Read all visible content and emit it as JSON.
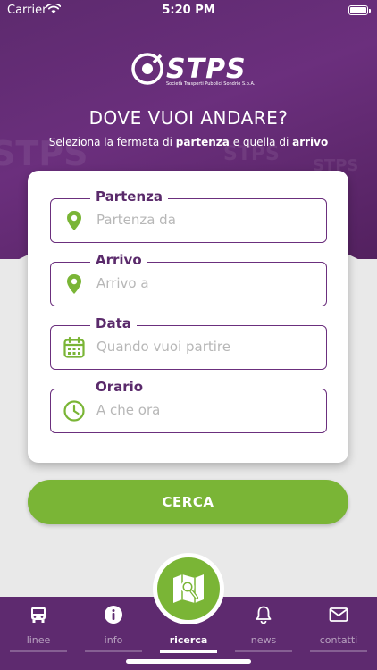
{
  "status_bar": {
    "carrier": "Carrier",
    "time": "5:20 PM"
  },
  "brand": {
    "name": "STPS",
    "tagline": "Società Trasporti Pubblici Sondrio S.p.A."
  },
  "header": {
    "title": "DOVE VUOI ANDARE?",
    "subtitle_prefix": "Seleziona la fermata di ",
    "subtitle_bold_1": "partenza",
    "subtitle_mid": " e quella di ",
    "subtitle_bold_2": "arrivo"
  },
  "form": {
    "fields": [
      {
        "label": "Partenza",
        "placeholder": "Partenza da",
        "icon": "location-pin-icon"
      },
      {
        "label": "Arrivo",
        "placeholder": "Arrivo a",
        "icon": "location-pin-icon"
      },
      {
        "label": "Data",
        "placeholder": "Quando vuoi partire",
        "icon": "calendar-icon"
      },
      {
        "label": "Orario",
        "placeholder": "A che ora",
        "icon": "clock-icon"
      }
    ],
    "submit_label": "CERCA"
  },
  "tabs": [
    {
      "label": "linee",
      "icon": "bus-icon",
      "active": false
    },
    {
      "label": "info",
      "icon": "info-icon",
      "active": false
    },
    {
      "label": "ricerca",
      "icon": "map-search-icon",
      "active": true
    },
    {
      "label": "news",
      "icon": "bell-icon",
      "active": false
    },
    {
      "label": "contatti",
      "icon": "mail-icon",
      "active": false
    }
  ],
  "colors": {
    "brand_purple": "#5e2a6f",
    "accent_green": "#7ab536",
    "placeholder_gray": "#b7b7b7"
  }
}
